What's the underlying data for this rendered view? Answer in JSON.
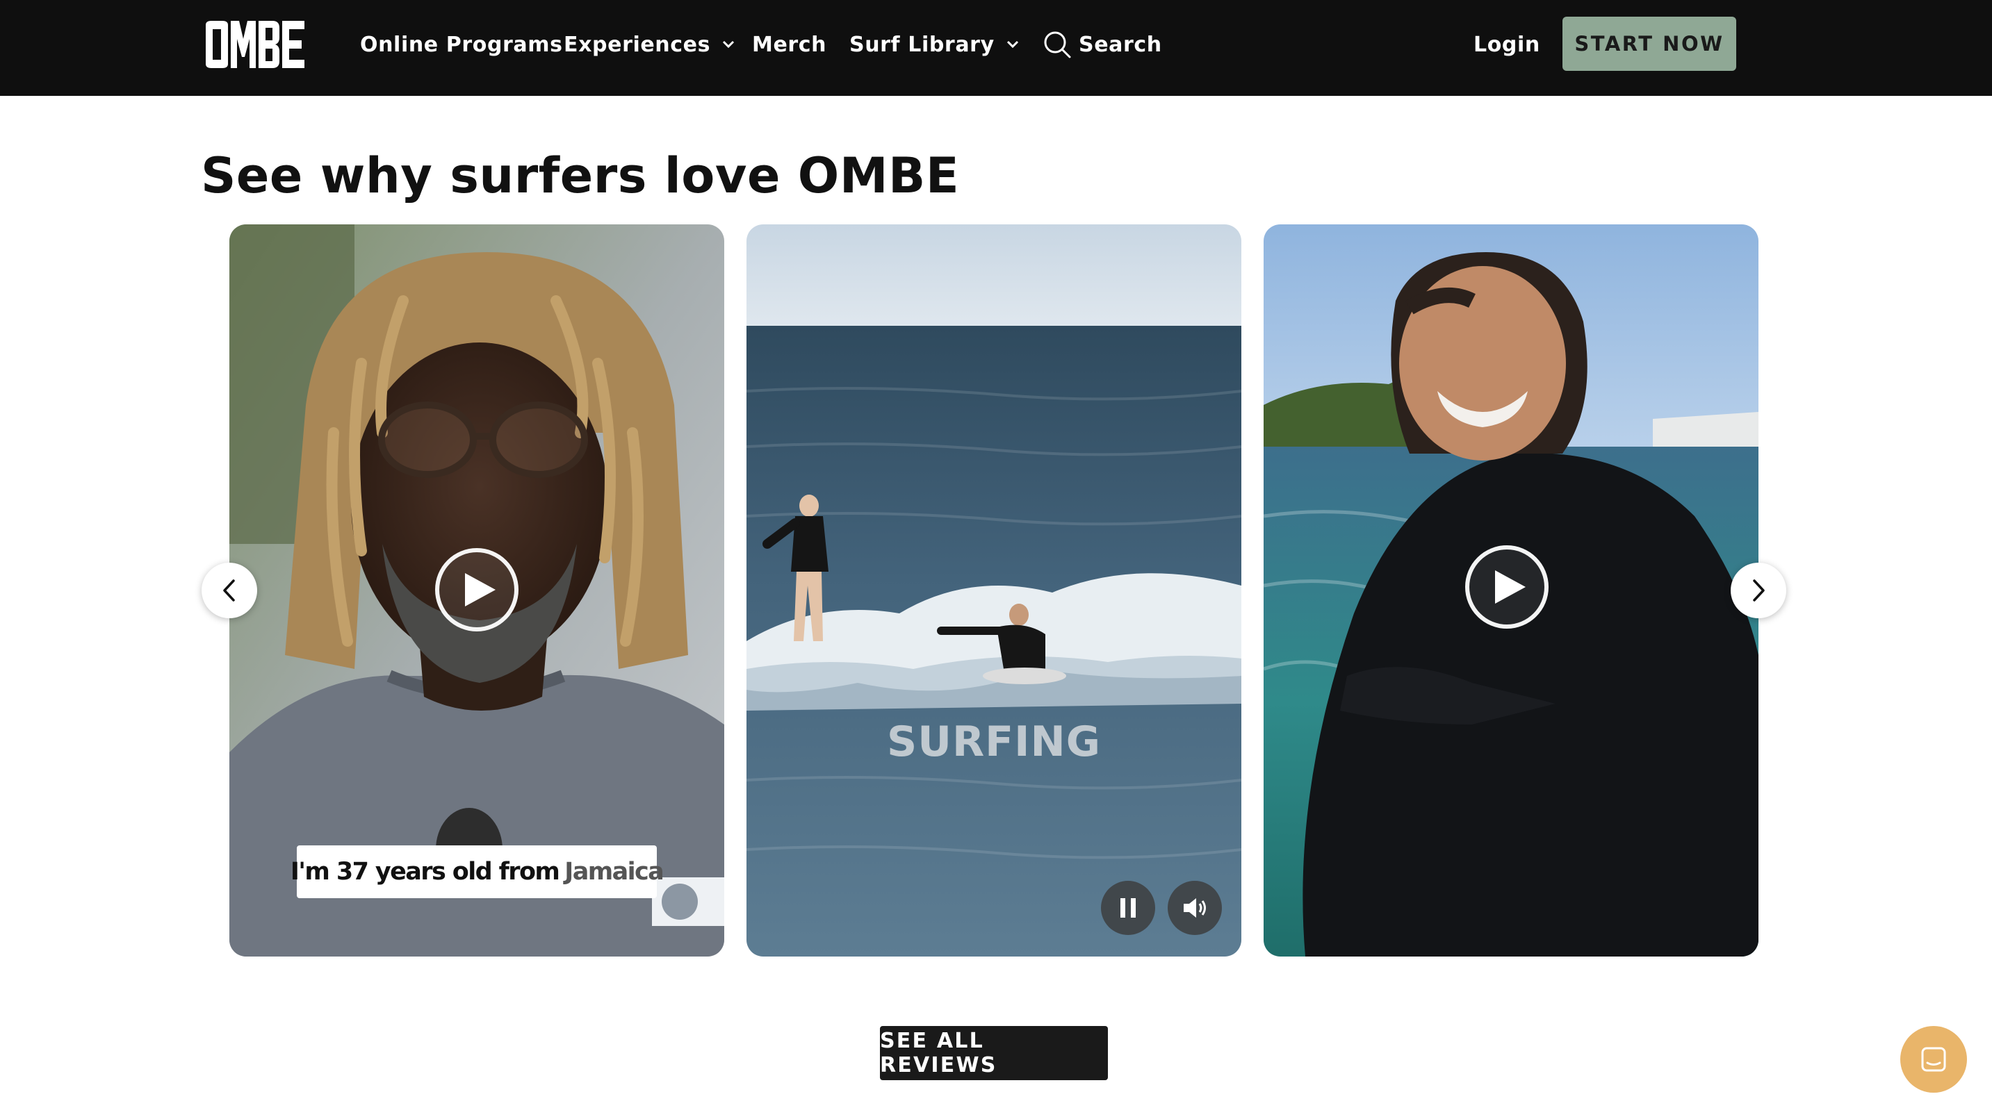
{
  "nav": {
    "logo_text": "OMBE",
    "links": [
      {
        "label": "Online Programs",
        "has_dropdown": false
      },
      {
        "label": "Experiences",
        "has_dropdown": true
      },
      {
        "label": "Merch",
        "has_dropdown": false
      },
      {
        "label": "Surf Library",
        "has_dropdown": true
      }
    ],
    "search_label": "Search",
    "login_label": "Login",
    "cta_label": "START NOW",
    "cta_color": "#8fa895"
  },
  "section": {
    "title": "See why surfers love OMBE"
  },
  "cards": [
    {
      "caption_main": "I'm 37 years old from",
      "caption_highlight": "Jamaica",
      "state": "paused"
    },
    {
      "overlay_text": "SURFING",
      "state": "playing"
    },
    {
      "state": "paused"
    }
  ],
  "controls": {
    "prev_icon": "chevron-left-icon",
    "next_icon": "chevron-right-icon",
    "pause_icon": "pause-icon",
    "volume_icon": "volume-icon"
  },
  "reviews_button_label": "SEE ALL REVIEWS",
  "chat_color": "#e9b56a"
}
